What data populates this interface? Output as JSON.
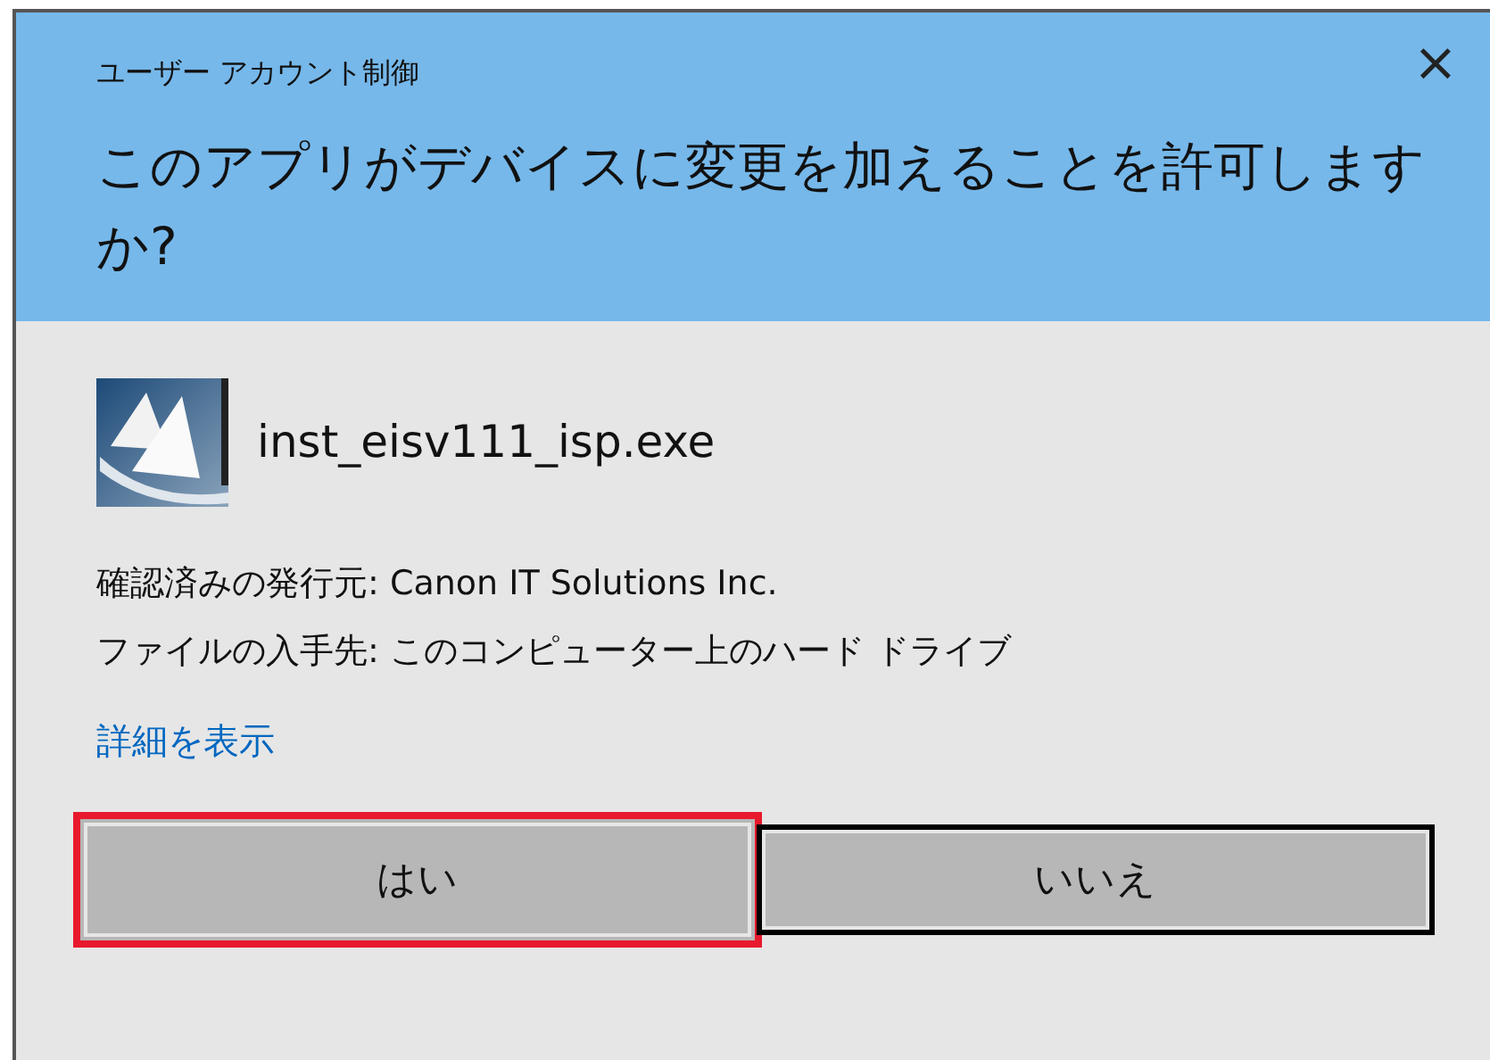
{
  "window": {
    "title": "ユーザー アカウント制御",
    "close": "×"
  },
  "question": "このアプリがデバイスに変更を加えることを許可しますか?",
  "program": {
    "file": "inst_eisv111_isp.exe"
  },
  "details": [
    "確認済みの発行元: Canon IT Solutions Inc.",
    "ファイルの入手先: このコンピューター上のハード ドライブ"
  ],
  "more_link": "詳細を表示",
  "buttons": [
    {
      "label": "はい",
      "focused": false,
      "highlighted": true
    },
    {
      "label": "いいえ",
      "focused": true,
      "highlighted": false
    }
  ]
}
